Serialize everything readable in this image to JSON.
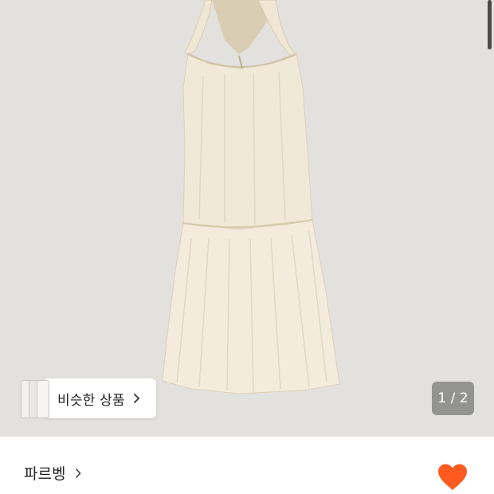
{
  "colors": {
    "gallery_background": "#e3e1de",
    "dress": "#f1e9d8",
    "heart": "#ff5a1f",
    "counter_background": "#7a7a7a"
  },
  "gallery": {
    "image_subject": "cream sleeveless tiered midi dress",
    "similar_products_label": "비슷한 상품",
    "page_counter": "1 / 2"
  },
  "product": {
    "brand": "파르벵",
    "liked": true
  },
  "icons": {
    "chevron": "chevron-right-icon",
    "heart": "heart-icon"
  }
}
